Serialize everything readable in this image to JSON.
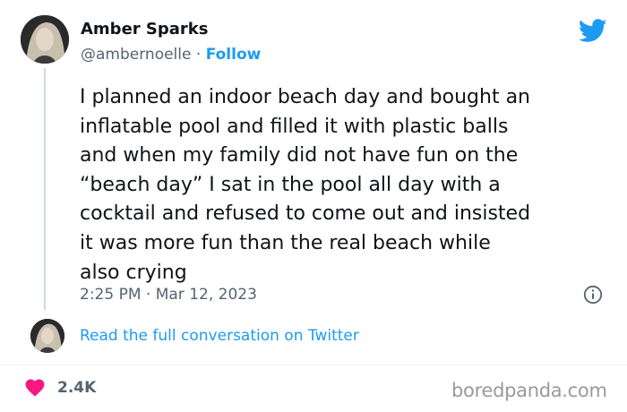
{
  "author": {
    "name": "Amber Sparks",
    "handle": "@ambernoelle",
    "separator": "·",
    "follow_label": "Follow"
  },
  "tweet": {
    "text": "I planned an indoor beach day and bought an\ninflatable pool and filled it with plastic balls\nand when my family did not have fun on the\n“beach day” I sat in the pool all day with a\ncocktail and refused to come out and insisted\nit was more fun than the real beach while\nalso crying",
    "timestamp": "2:25 PM · Mar 12, 2023"
  },
  "conversation": {
    "link_label": "Read the full conversation on Twitter"
  },
  "engagement": {
    "likes": "2.4K"
  },
  "watermark": "boredpanda.com",
  "icons": {
    "brand": "twitter-bird-icon",
    "info": "info-icon",
    "like": "heart-icon"
  },
  "colors": {
    "accent": "#1d9bf0",
    "heart": "#f91880",
    "secondary_text": "#536471",
    "primary_text": "#0f1419"
  }
}
